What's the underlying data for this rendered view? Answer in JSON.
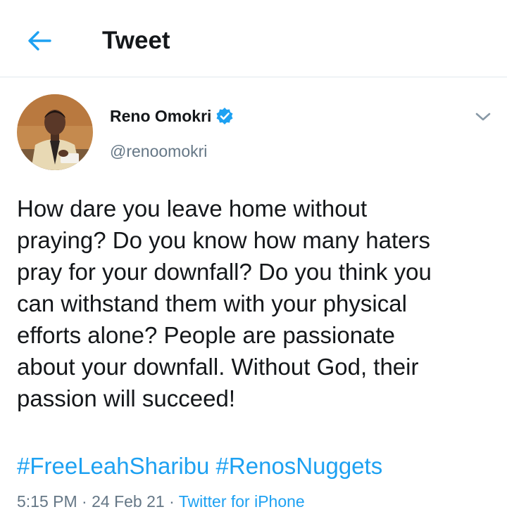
{
  "header": {
    "title": "Tweet"
  },
  "tweet": {
    "author": {
      "name": "Reno Omokri",
      "handle": "@renoomokri",
      "verified": true
    },
    "text": "How dare you leave home without\npraying? Do you know how many haters\npray for your downfall? Do you think you\ncan withstand them with your physical\nefforts alone? People are passionate\nabout your downfall. Without God, their\npassion will succeed!",
    "hashtags": [
      "#FreeLeahSharibu",
      "#RenosNuggets"
    ],
    "time": "5:15 PM",
    "separator": "·",
    "date": "24 Feb 21",
    "source": "Twitter for iPhone"
  },
  "icons": {
    "back": "arrow-left-icon",
    "verified": "verified-badge-icon",
    "caret": "chevron-down-icon"
  },
  "colors": {
    "accent": "#1da1f2",
    "text": "#14171a",
    "secondary": "#657786",
    "divider": "#e1e8ed"
  }
}
